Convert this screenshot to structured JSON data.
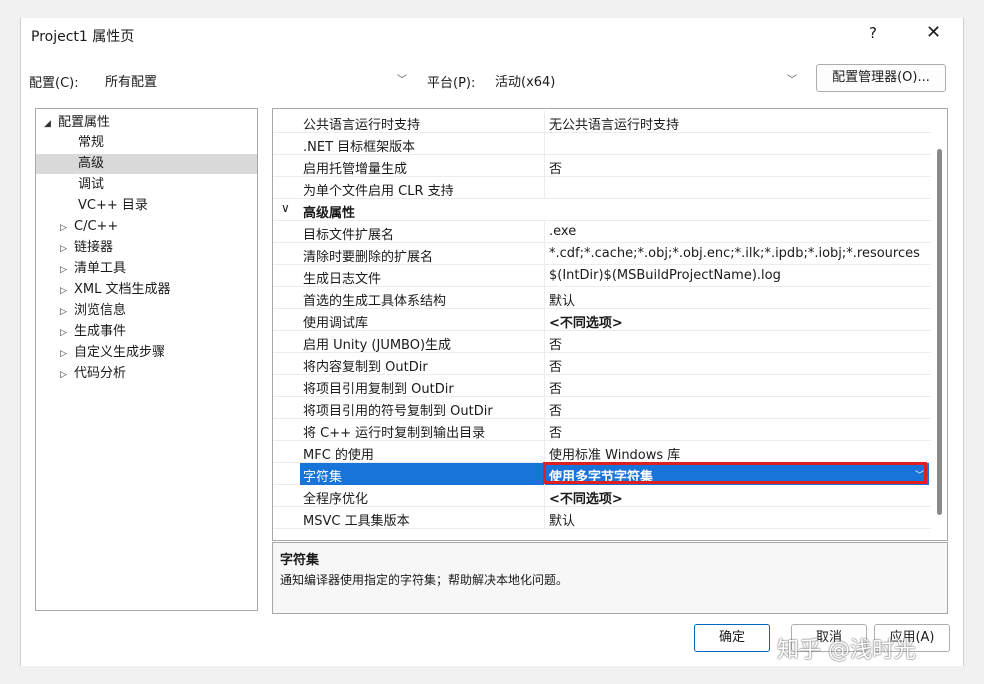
{
  "window": {
    "title": "Project1 属性页",
    "help": "?",
    "close": "✕"
  },
  "config": {
    "label": "配置(C):",
    "value": "所有配置",
    "platform_label": "平台(P):",
    "platform_value": "活动(x64)",
    "manager_button": "配置管理器(O)..."
  },
  "tree": {
    "root": "配置属性",
    "items": [
      {
        "label": "常规"
      },
      {
        "label": "高级",
        "selected": true
      },
      {
        "label": "调试"
      },
      {
        "label": "VC++ 目录"
      },
      {
        "label": "C/C++",
        "expandable": true
      },
      {
        "label": "链接器",
        "expandable": true
      },
      {
        "label": "清单工具",
        "expandable": true
      },
      {
        "label": "XML 文档生成器",
        "expandable": true
      },
      {
        "label": "浏览信息",
        "expandable": true
      },
      {
        "label": "生成事件",
        "expandable": true
      },
      {
        "label": "自定义生成步骤",
        "expandable": true
      },
      {
        "label": "代码分析",
        "expandable": true
      }
    ]
  },
  "grid": {
    "rows": [
      {
        "name": "公共语言运行时支持",
        "value": "无公共语言运行时支持"
      },
      {
        "name": ".NET 目标框架版本",
        "value": ""
      },
      {
        "name": "启用托管增量生成",
        "value": "否"
      },
      {
        "name": "为单个文件启用 CLR 支持",
        "value": ""
      },
      {
        "name": "高级属性",
        "value": "",
        "category": true
      },
      {
        "name": "目标文件扩展名",
        "value": ".exe"
      },
      {
        "name": "清除时要删除的扩展名",
        "value": "*.cdf;*.cache;*.obj;*.obj.enc;*.ilk;*.ipdb;*.iobj;*.resources"
      },
      {
        "name": "生成日志文件",
        "value": "$(IntDir)$(MSBuildProjectName).log"
      },
      {
        "name": "首选的生成工具体系结构",
        "value": "默认"
      },
      {
        "name": "使用调试库",
        "value": "<不同选项>",
        "bold": true
      },
      {
        "name": "启用 Unity (JUMBO)生成",
        "value": "否"
      },
      {
        "name": "将内容复制到 OutDir",
        "value": "否"
      },
      {
        "name": "将项目引用复制到 OutDir",
        "value": "否"
      },
      {
        "name": "将项目引用的符号复制到 OutDir",
        "value": "否"
      },
      {
        "name": "将 C++ 运行时复制到输出目录",
        "value": "否"
      },
      {
        "name": "MFC 的使用",
        "value": "使用标准 Windows 库"
      },
      {
        "name": "字符集",
        "value": "使用多字节字符集",
        "selected": true
      },
      {
        "name": "全程序优化",
        "value": "<不同选项>",
        "bold": true
      },
      {
        "name": "MSVC 工具集版本",
        "value": "默认"
      }
    ]
  },
  "description": {
    "title": "字符集",
    "text": "通知编译器使用指定的字符集；帮助解决本地化问题。"
  },
  "buttons": {
    "ok": "确定",
    "cancel": "取消",
    "apply": "应用(A)"
  },
  "watermark": "知乎 @浅时光"
}
